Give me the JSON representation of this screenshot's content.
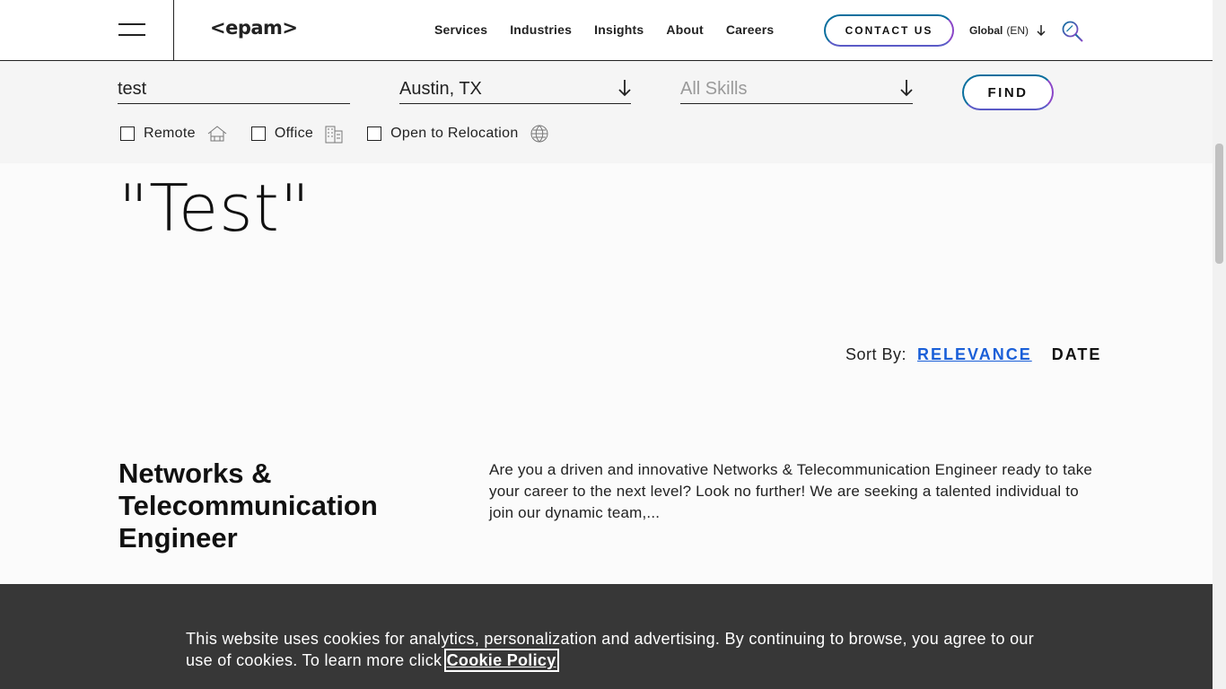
{
  "header": {
    "logo": "<epam>",
    "nav": [
      "Services",
      "Industries",
      "Insights",
      "About",
      "Careers"
    ],
    "contact_label": "CONTACT US",
    "lang_label": "Global",
    "lang_code": "(EN)"
  },
  "filters": {
    "keyword_value": "test",
    "location_value": "Austin, TX",
    "skills_placeholder": "All Skills",
    "find_label": "FIND",
    "remote_label": "Remote",
    "office_label": "Office",
    "relocation_label": "Open to Relocation"
  },
  "results": {
    "heading_quote": "\"Test\"",
    "sort_label": "Sort By:",
    "sort_relevance": "RELEVANCE",
    "sort_date": "DATE"
  },
  "job": {
    "title": "Networks & Telecommunication Engineer",
    "description": "Are you a driven and innovative Networks & Telecommunication Engineer ready to take your career to the next level? Look no further! We are seeking a talented individual to join our dynamic team,..."
  },
  "cookie": {
    "text": "This website uses cookies for analytics, personalization and advertising. By continuing to browse, you agree to our use of cookies. To learn more click ",
    "link": "Cookie Policy"
  },
  "colors": {
    "accent_blue": "#1a5fd8",
    "gradient_start": "#0a6f9e",
    "gradient_end": "#8b47c8"
  }
}
